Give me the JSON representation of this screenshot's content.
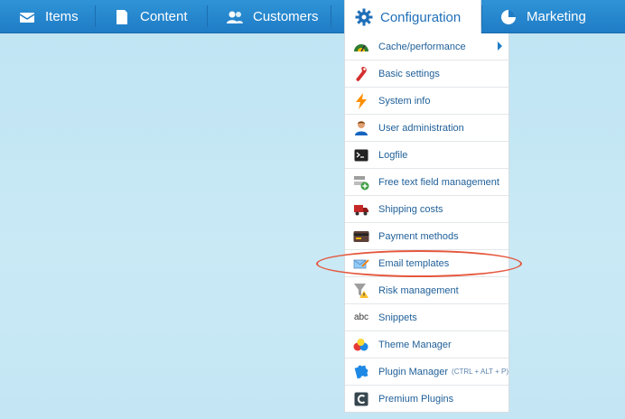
{
  "topnav": {
    "items": [
      {
        "label": "Items",
        "icon": "items-icon"
      },
      {
        "label": "Content",
        "icon": "content-icon"
      },
      {
        "label": "Customers",
        "icon": "customers-icon"
      },
      {
        "label": "Configuration",
        "icon": "gear-icon"
      },
      {
        "label": "Marketing",
        "icon": "pie-chart-icon"
      }
    ]
  },
  "menu": {
    "items": [
      {
        "label": "Cache/performance",
        "icon": "speedometer-icon"
      },
      {
        "label": "Basic settings",
        "icon": "wrench-icon"
      },
      {
        "label": "System info",
        "icon": "lightning-icon"
      },
      {
        "label": "User administration",
        "icon": "user-icon"
      },
      {
        "label": "Logfile",
        "icon": "terminal-icon"
      },
      {
        "label": "Free text field management",
        "icon": "add-field-icon"
      },
      {
        "label": "Shipping costs",
        "icon": "truck-icon"
      },
      {
        "label": "Payment methods",
        "icon": "credit-card-icon"
      },
      {
        "label": "Email templates",
        "icon": "email-template-icon"
      },
      {
        "label": "Risk management",
        "icon": "filter-warning-icon"
      },
      {
        "label": "Snippets",
        "icon": "abc-icon"
      },
      {
        "label": "Theme Manager",
        "icon": "paint-drops-icon"
      },
      {
        "label": "Plugin Manager",
        "hint": "(CTRL + ALT + P)",
        "icon": "puzzle-icon"
      },
      {
        "label": "Premium Plugins",
        "icon": "premium-plugins-icon"
      }
    ]
  },
  "colors": {
    "topbar": "#2088cf",
    "menu_text": "#1f5f98",
    "highlight": "#e5573d"
  }
}
